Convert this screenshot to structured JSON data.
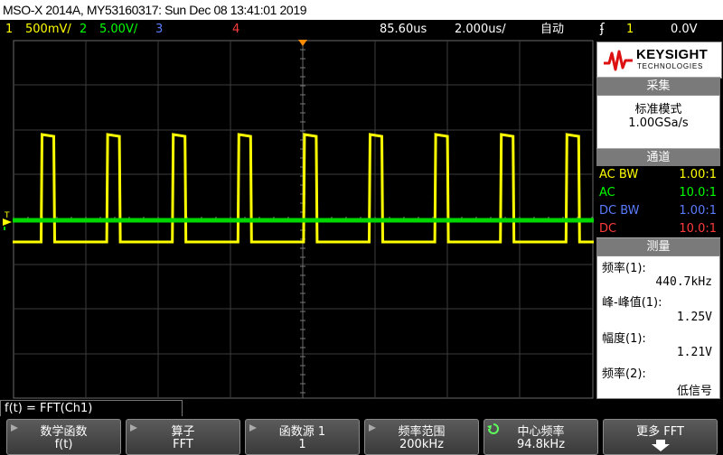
{
  "title_bar": {
    "text": "MSO-X 2014A, MY53160317: Sun Dec 08 13:41:01 2019"
  },
  "status": {
    "ch1_num": "1",
    "ch1_scale": "500mV/",
    "ch2_num": "2",
    "ch2_scale": "5.00V/",
    "ch3_num": "3",
    "ch4_num": "4",
    "time_delay": "85.60us",
    "time_scale": "2.000us/",
    "trigger_mode": "自动",
    "trigger_source": "1",
    "trigger_level": "0.0V"
  },
  "colors": {
    "ch1": "#ffff00",
    "ch2": "#00ff00",
    "ch3": "#5b7cff",
    "ch4": "#ff3b3b",
    "trigger_marker": "#ff8c00"
  },
  "panel": {
    "brand": "KEYSIGHT",
    "brand_sub": "TECHNOLOGIES",
    "acq_header": "采集",
    "acq_mode": "标准模式",
    "acq_rate": "1.00GSa/s",
    "channels_header": "通道",
    "channels": [
      {
        "coupling": "AC BW",
        "probe": "1.00:1"
      },
      {
        "coupling": "AC",
        "probe": "10.0:1"
      },
      {
        "coupling": "DC BW",
        "probe": "1.00:1"
      },
      {
        "coupling": "DC",
        "probe": "10.0:1"
      }
    ],
    "measure_header": "测量",
    "measurements": [
      {
        "label": "频率(1):",
        "value": "440.7kHz"
      },
      {
        "label": "峰-峰值(1):",
        "value": "1.25V"
      },
      {
        "label": "幅度(1):",
        "value": "1.21V"
      },
      {
        "label": "频率(2):",
        "value": "低信号"
      }
    ]
  },
  "function_bar": {
    "text": "f(t) = FFT(Ch1)"
  },
  "softkeys": [
    {
      "title": "数学函数",
      "value": "f(t)"
    },
    {
      "title": "算子",
      "value": "FFT"
    },
    {
      "title": "函数源 1",
      "value": "1"
    },
    {
      "title": "频率范围",
      "value": "200kHz"
    },
    {
      "title": "中心频率",
      "value": "94.8kHz"
    },
    {
      "title": "更多 FFT",
      "value": ""
    }
  ],
  "waveform": {
    "ch1_pulse_count": 9,
    "ground_marker_label": "1",
    "trigger_marker_label": "T"
  }
}
